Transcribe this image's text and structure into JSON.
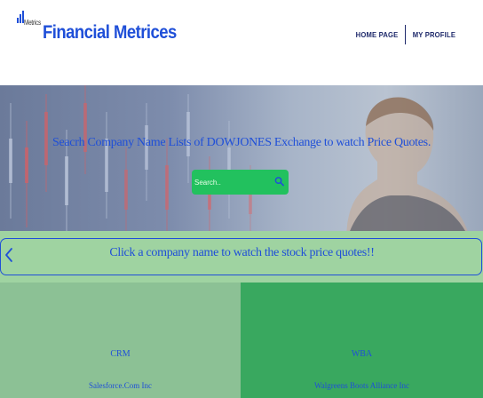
{
  "header": {
    "logo_text": "Metrics",
    "brand": "Financial Metrices",
    "nav": {
      "home": "HOME PAGE",
      "profile": "MY PROFILE"
    }
  },
  "hero": {
    "title": "Seacrh Company Name Lists of DOWJONES Exchange to watch Price Quotes.",
    "search": {
      "placeholder": "Search..",
      "value": ""
    }
  },
  "prompt": {
    "text": "Click a company name to watch the stock price quotes!!"
  },
  "companies": [
    {
      "symbol": "CRM",
      "name": "Salesforce.Com Inc"
    },
    {
      "symbol": "WBA",
      "name": "Walgreens Boots Alliance Inc"
    }
  ],
  "colors": {
    "brand": "#1f4fd8",
    "search_bg": "#22c15e",
    "prompt_bg": "#9fd3a1",
    "card_1": "#8cc195",
    "card_2": "#39a85f"
  },
  "icons": {
    "logo": "bar-chart-icon",
    "search": "search-icon",
    "back": "chevron-left-icon"
  }
}
